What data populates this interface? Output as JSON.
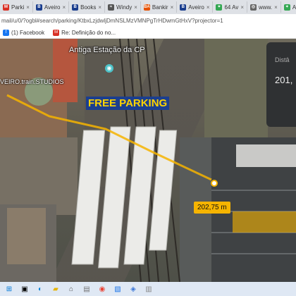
{
  "tabs": [
    {
      "label": "Parki",
      "icon": "gmail-icon",
      "color": "#d93025",
      "glyph": "M"
    },
    {
      "label": "Aveiro",
      "icon": "booking-icon",
      "color": "#1b3e8e",
      "glyph": "B"
    },
    {
      "label": "Books",
      "icon": "booking-icon",
      "color": "#1b3e8e",
      "glyph": "B"
    },
    {
      "label": "Windy",
      "icon": "windy-icon",
      "color": "#555555",
      "glyph": "≈"
    },
    {
      "label": "Bankir",
      "icon": "bank-icon",
      "color": "#e65100",
      "glyph": "BA"
    },
    {
      "label": "Aveiro",
      "icon": "booking-icon",
      "color": "#1b3e8e",
      "glyph": "B"
    },
    {
      "label": "64 Av",
      "icon": "maps-icon",
      "color": "#34a853",
      "glyph": "⌖"
    },
    {
      "label": "www.",
      "icon": "web-icon",
      "color": "#666666",
      "glyph": "◎"
    },
    {
      "label": "Aveiro",
      "icon": "maps-icon",
      "color": "#34a853",
      "glyph": "⌖"
    }
  ],
  "address": "mail/u/0/?ogbl#search/parking/KtbxLzjdwljDmNSLMzVMNPgTrHDwmGtHxV?projector=1",
  "bookmarks": [
    {
      "label": "(1) Facebook",
      "icon": "facebook-icon",
      "color": "#1877f2",
      "glyph": "f"
    },
    {
      "label": "Re: Definição do no...",
      "icon": "gmail-icon",
      "color": "#d93025",
      "glyph": "M"
    }
  ],
  "map": {
    "station_label": "Antiga Estação da CP",
    "studio_label": "VEIRO.train.STUDIOS",
    "free_parking": "FREE PARKING",
    "measurement": "202,75 m",
    "distance_label": "Distâ",
    "distance_value": "201,"
  },
  "colors": {
    "accent": "#f6b400",
    "free_parking_text": "#ffd400",
    "free_parking_bg": "#1b3e8e"
  }
}
